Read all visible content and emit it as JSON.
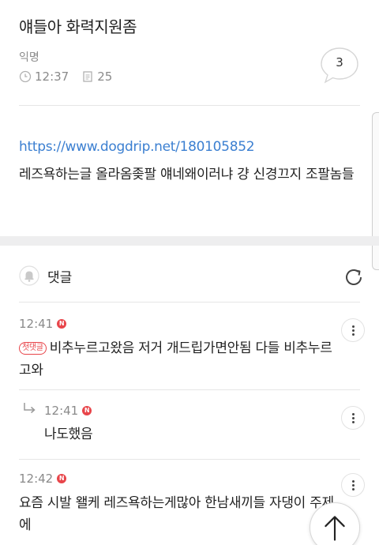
{
  "post": {
    "title": "얘들아 화력지원좀",
    "author": "익명",
    "time": "12:37",
    "views": "25",
    "comment_count": "3",
    "link": "https://www.dogdrip.net/180105852",
    "body": "레즈욕하는글 올라옴좆팔 얘네왜이러냐 걍 신경끄지 조팔놈들"
  },
  "comments_section": {
    "title": "댓글"
  },
  "comments": [
    {
      "time": "12:41",
      "new_badge": "N",
      "first_badge": "첫댓글",
      "text": "비추누르고왔음 저거 개드립가면안됨 다들 비추누르고와"
    },
    {
      "time": "12:41",
      "new_badge": "N",
      "text": "나도했음"
    },
    {
      "time": "12:42",
      "new_badge": "N",
      "text": "요즘 시발 왤케 레즈욕하는게많아 한남새끼들 자댕이 주제에"
    }
  ],
  "colors": {
    "link": "#3b7fd1",
    "badge_red": "#e8454a",
    "muted": "#8a8a8a",
    "band": "#eeeeef"
  },
  "icons": [
    "clock-icon",
    "document-icon",
    "speech-bubble-icon",
    "bell-icon",
    "refresh-icon",
    "more-vertical-icon",
    "reply-arrow-icon",
    "arrow-up-icon"
  ]
}
